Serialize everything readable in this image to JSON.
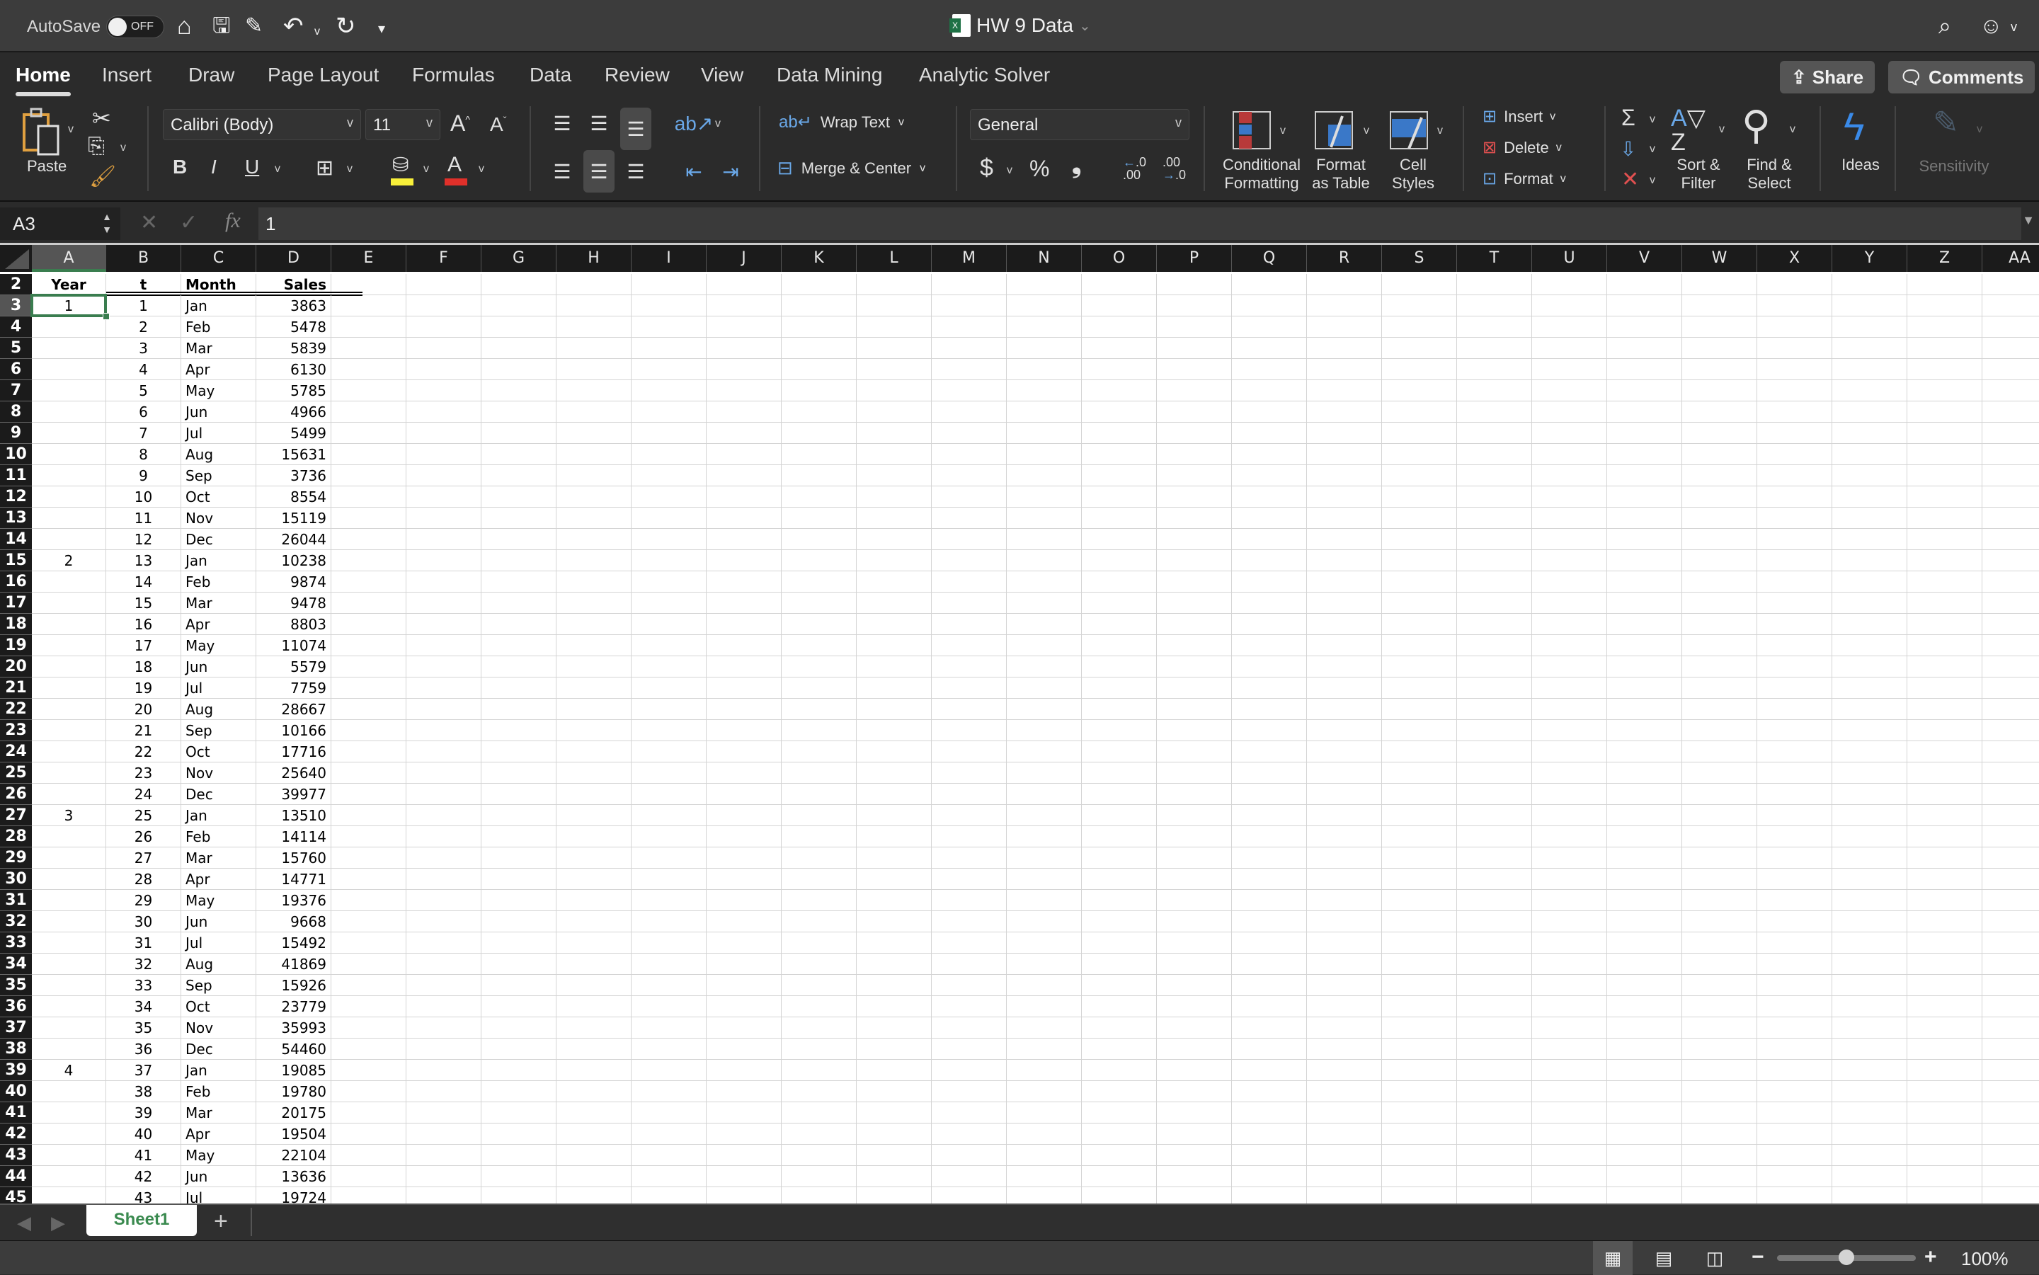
{
  "titlebar": {
    "autosave_label": "AutoSave",
    "autosave_state": "OFF",
    "doc_title": "HW 9 Data",
    "quick_access": [
      "home-icon",
      "save-icon",
      "edit-icon",
      "undo-icon",
      "redo-icon",
      "customize-icon"
    ]
  },
  "tabs": [
    {
      "label": "Home",
      "active": true
    },
    {
      "label": "Insert"
    },
    {
      "label": "Draw"
    },
    {
      "label": "Page Layout"
    },
    {
      "label": "Formulas"
    },
    {
      "label": "Data"
    },
    {
      "label": "Review"
    },
    {
      "label": "View"
    },
    {
      "label": "Data Mining"
    },
    {
      "label": "Analytic Solver"
    }
  ],
  "share_label": "Share",
  "comments_label": "Comments",
  "ribbon": {
    "paste_label": "Paste",
    "font_name": "Calibri (Body)",
    "font_size": "11",
    "bold": "B",
    "italic": "I",
    "underline": "U",
    "wrap_text": "Wrap Text",
    "merge_center": "Merge & Center",
    "number_format": "General",
    "currency": "$",
    "percent": "%",
    "comma": "❟",
    "conditional_formatting": [
      "Conditional",
      "Formatting"
    ],
    "format_as_table": [
      "Format",
      "as Table"
    ],
    "cell_styles": [
      "Cell",
      "Styles"
    ],
    "insert": "Insert",
    "delete": "Delete",
    "format": "Format",
    "sort_filter": [
      "Sort &",
      "Filter"
    ],
    "find_select": [
      "Find &",
      "Select"
    ],
    "ideas": "Ideas",
    "sensitivity": "Sensitivity"
  },
  "formula_bar": {
    "name_box": "A3",
    "formula": "1"
  },
  "columns": [
    "A",
    "B",
    "C",
    "D",
    "E",
    "F",
    "G",
    "H",
    "I",
    "J",
    "K",
    "L",
    "M",
    "N",
    "O",
    "P",
    "Q",
    "R",
    "S",
    "T",
    "U",
    "V",
    "W",
    "X",
    "Y",
    "Z",
    "AA"
  ],
  "selected_cell": "A3",
  "header_row": {
    "row": 2,
    "year": "Year",
    "t": "t",
    "month": "Month",
    "sales": "Sales"
  },
  "rows": [
    {
      "row": 3,
      "year": "1",
      "t": "1",
      "month": "Jan",
      "sales": "3863"
    },
    {
      "row": 4,
      "year": "",
      "t": "2",
      "month": "Feb",
      "sales": "5478"
    },
    {
      "row": 5,
      "year": "",
      "t": "3",
      "month": "Mar",
      "sales": "5839"
    },
    {
      "row": 6,
      "year": "",
      "t": "4",
      "month": "Apr",
      "sales": "6130"
    },
    {
      "row": 7,
      "year": "",
      "t": "5",
      "month": "May",
      "sales": "5785"
    },
    {
      "row": 8,
      "year": "",
      "t": "6",
      "month": "Jun",
      "sales": "4966"
    },
    {
      "row": 9,
      "year": "",
      "t": "7",
      "month": "Jul",
      "sales": "5499"
    },
    {
      "row": 10,
      "year": "",
      "t": "8",
      "month": "Aug",
      "sales": "15631"
    },
    {
      "row": 11,
      "year": "",
      "t": "9",
      "month": "Sep",
      "sales": "3736"
    },
    {
      "row": 12,
      "year": "",
      "t": "10",
      "month": "Oct",
      "sales": "8554"
    },
    {
      "row": 13,
      "year": "",
      "t": "11",
      "month": "Nov",
      "sales": "15119"
    },
    {
      "row": 14,
      "year": "",
      "t": "12",
      "month": "Dec",
      "sales": "26044"
    },
    {
      "row": 15,
      "year": "2",
      "t": "13",
      "month": "Jan",
      "sales": "10238"
    },
    {
      "row": 16,
      "year": "",
      "t": "14",
      "month": "Feb",
      "sales": "9874"
    },
    {
      "row": 17,
      "year": "",
      "t": "15",
      "month": "Mar",
      "sales": "9478"
    },
    {
      "row": 18,
      "year": "",
      "t": "16",
      "month": "Apr",
      "sales": "8803"
    },
    {
      "row": 19,
      "year": "",
      "t": "17",
      "month": "May",
      "sales": "11074"
    },
    {
      "row": 20,
      "year": "",
      "t": "18",
      "month": "Jun",
      "sales": "5579"
    },
    {
      "row": 21,
      "year": "",
      "t": "19",
      "month": "Jul",
      "sales": "7759"
    },
    {
      "row": 22,
      "year": "",
      "t": "20",
      "month": "Aug",
      "sales": "28667"
    },
    {
      "row": 23,
      "year": "",
      "t": "21",
      "month": "Sep",
      "sales": "10166"
    },
    {
      "row": 24,
      "year": "",
      "t": "22",
      "month": "Oct",
      "sales": "17716"
    },
    {
      "row": 25,
      "year": "",
      "t": "23",
      "month": "Nov",
      "sales": "25640"
    },
    {
      "row": 26,
      "year": "",
      "t": "24",
      "month": "Dec",
      "sales": "39977"
    },
    {
      "row": 27,
      "year": "3",
      "t": "25",
      "month": "Jan",
      "sales": "13510"
    },
    {
      "row": 28,
      "year": "",
      "t": "26",
      "month": "Feb",
      "sales": "14114"
    },
    {
      "row": 29,
      "year": "",
      "t": "27",
      "month": "Mar",
      "sales": "15760"
    },
    {
      "row": 30,
      "year": "",
      "t": "28",
      "month": "Apr",
      "sales": "14771"
    },
    {
      "row": 31,
      "year": "",
      "t": "29",
      "month": "May",
      "sales": "19376"
    },
    {
      "row": 32,
      "year": "",
      "t": "30",
      "month": "Jun",
      "sales": "9668"
    },
    {
      "row": 33,
      "year": "",
      "t": "31",
      "month": "Jul",
      "sales": "15492"
    },
    {
      "row": 34,
      "year": "",
      "t": "32",
      "month": "Aug",
      "sales": "41869"
    },
    {
      "row": 35,
      "year": "",
      "t": "33",
      "month": "Sep",
      "sales": "15926"
    },
    {
      "row": 36,
      "year": "",
      "t": "34",
      "month": "Oct",
      "sales": "23779"
    },
    {
      "row": 37,
      "year": "",
      "t": "35",
      "month": "Nov",
      "sales": "35993"
    },
    {
      "row": 38,
      "year": "",
      "t": "36",
      "month": "Dec",
      "sales": "54460"
    },
    {
      "row": 39,
      "year": "4",
      "t": "37",
      "month": "Jan",
      "sales": "19085"
    },
    {
      "row": 40,
      "year": "",
      "t": "38",
      "month": "Feb",
      "sales": "19780"
    },
    {
      "row": 41,
      "year": "",
      "t": "39",
      "month": "Mar",
      "sales": "20175"
    },
    {
      "row": 42,
      "year": "",
      "t": "40",
      "month": "Apr",
      "sales": "19504"
    },
    {
      "row": 43,
      "year": "",
      "t": "41",
      "month": "May",
      "sales": "22104"
    },
    {
      "row": 44,
      "year": "",
      "t": "42",
      "month": "Jun",
      "sales": "13636"
    },
    {
      "row": 45,
      "year": "",
      "t": "43",
      "month": "Jul",
      "sales": "19724"
    }
  ],
  "sheets": [
    {
      "label": "Sheet1",
      "active": true
    }
  ],
  "status": {
    "zoom_label": "100%",
    "zoom_percent": 100
  },
  "colors": {
    "accent_green": "#3a7d4f",
    "sheet_tab_text": "#3a8a4f",
    "ribbon_bg": "#2b2b2b",
    "titlebar_bg": "#3c3c3c"
  }
}
